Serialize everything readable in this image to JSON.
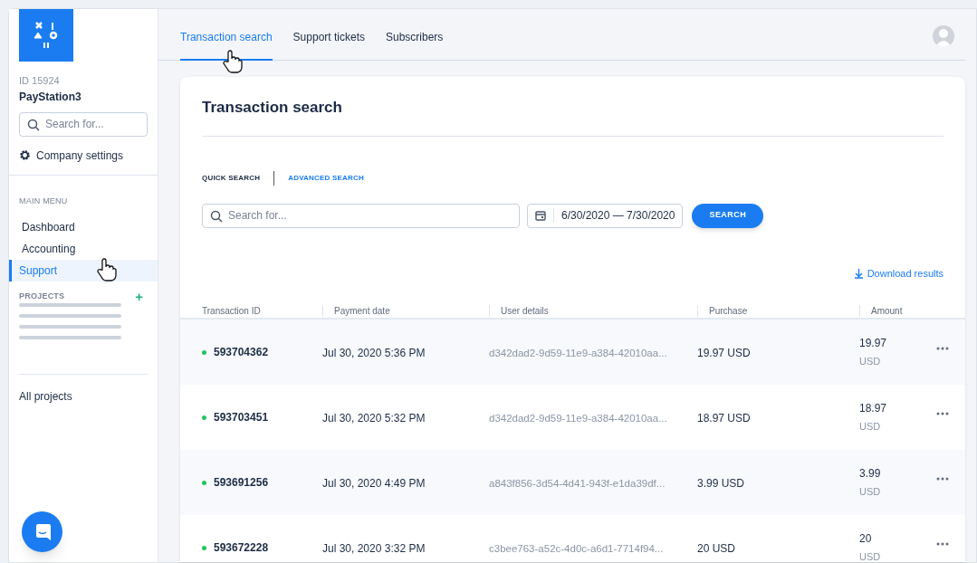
{
  "sidebar": {
    "account_id": "ID 15924",
    "account_name": "PayStation3",
    "search": {
      "placeholder": "Search for..."
    },
    "settings_label": "Company settings",
    "main_menu_heading": "MAIN MENU",
    "menu_items": [
      {
        "label": "Dashboard",
        "selected": false
      },
      {
        "label": "Accounting",
        "selected": false
      },
      {
        "label": "Support",
        "selected": true
      }
    ],
    "projects_heading": "PROJECTS",
    "add_project": "+",
    "all_projects": "All projects"
  },
  "tabs": [
    {
      "label": "Transaction search",
      "selected": true
    },
    {
      "label": "Support tickets",
      "selected": false
    },
    {
      "label": "Subscribers",
      "selected": false
    }
  ],
  "card": {
    "title": "Transaction search",
    "search_modes": [
      {
        "label": "QUICK SEARCH",
        "selected": true
      },
      {
        "label": "ADVANCED SEARCH",
        "selected": false
      }
    ],
    "search": {
      "placeholder": "Search for..."
    },
    "date_range": "6/30/2020 — 7/30/2020",
    "search_button": "SEARCH",
    "download": "Download results",
    "table": {
      "columns": [
        "Transaction ID",
        "Payment date",
        "User details",
        "Purchase",
        "Amount"
      ],
      "rows": [
        {
          "id": "593704362",
          "color": "#22c55e",
          "date": "Jul 30, 2020 5:36 PM",
          "user": "d342dad2-9d59-11e9-a384-42010aa...",
          "purchase": "19.97 USD",
          "amount": "19.97",
          "currency": "USD"
        },
        {
          "id": "593703451",
          "color": "#22c55e",
          "date": "Jul 30, 2020 5:32 PM",
          "user": "d342dad2-9d59-11e9-a384-42010aa...",
          "purchase": "18.97 USD",
          "amount": "18.97",
          "currency": "USD"
        },
        {
          "id": "593691256",
          "color": "#22c55e",
          "date": "Jul 30, 2020 4:49 PM",
          "user": "a843f856-3d54-4d41-943f-e1da39df...",
          "purchase": "3.99 USD",
          "amount": "3.99",
          "currency": "USD"
        },
        {
          "id": "593672228",
          "color": "#22c55e",
          "date": "Jul 30, 2020 3:32 PM",
          "user": "c3bee763-a52c-4d0c-a6d1-7714f94...",
          "purchase": "20 USD",
          "amount": "20",
          "currency": "USD"
        }
      ]
    }
  }
}
